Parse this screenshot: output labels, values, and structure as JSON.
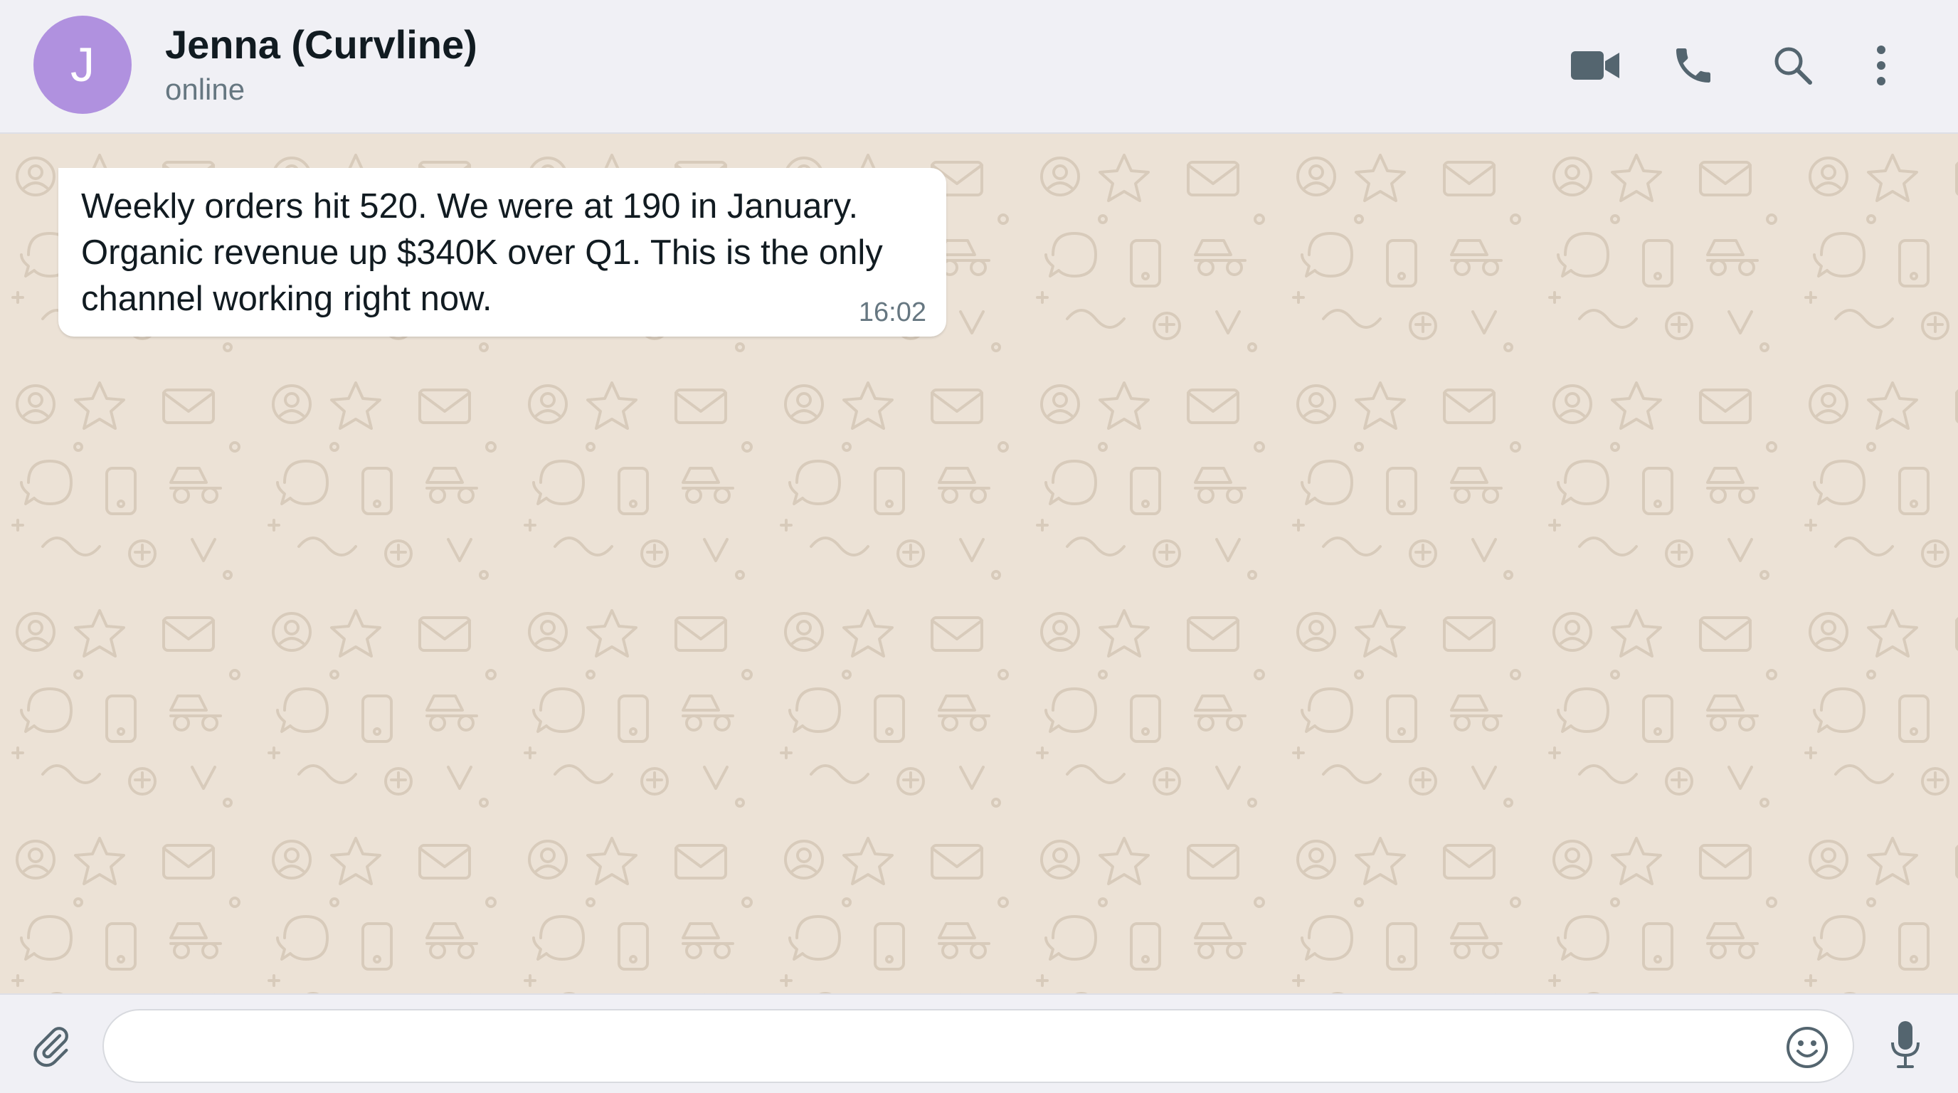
{
  "header": {
    "avatar_initial": "J",
    "avatar_color": "#b091df",
    "contact_name": "Jenna (Curvline)",
    "status": "online",
    "icons": [
      "video-call-icon",
      "voice-call-icon",
      "search-icon",
      "more-options-icon"
    ]
  },
  "chat": {
    "wallpaper_color": "#ece2d6",
    "messages": [
      {
        "direction": "incoming",
        "text": "Weekly orders hit 520. We were at 190 in January. Organic revenue up $340K over Q1. This is the only channel working right now.",
        "time": "16:02"
      }
    ]
  },
  "composer": {
    "value": "",
    "placeholder": "",
    "icons": [
      "attach-icon",
      "emoji-icon",
      "microphone-icon"
    ]
  },
  "colors": {
    "header_bg": "#f0f0f5",
    "bubble_bg": "#ffffff",
    "icon_gray": "#54656f"
  }
}
